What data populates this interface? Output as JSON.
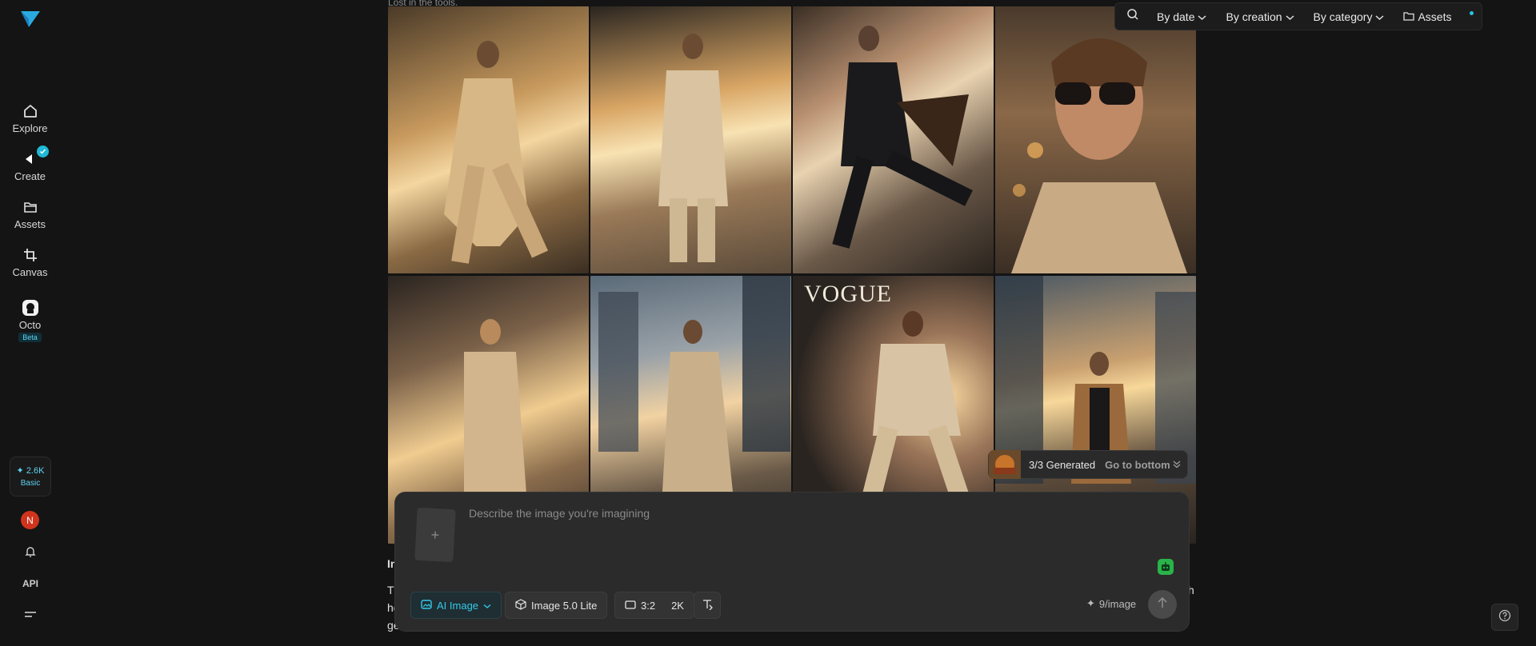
{
  "sidebar": {
    "nav": [
      {
        "label": "Explore",
        "icon": "home-icon"
      },
      {
        "label": "Create",
        "icon": "sparkle-pen-icon"
      },
      {
        "label": "Assets",
        "icon": "folder-icon"
      },
      {
        "label": "Canvas",
        "icon": "crop-icon"
      },
      {
        "label": "Octo",
        "icon": "octo-icon",
        "badge": "Beta"
      }
    ],
    "credits_value": "2.6K",
    "credits_tier": "Basic",
    "avatar_initial": "N",
    "api_label": "API"
  },
  "topbar": {
    "by_date": "By date",
    "by_creation": "By creation",
    "by_category": "By category",
    "assets": "Assets"
  },
  "header_cut_text": "Lost in the tools.",
  "generated": {
    "status": "3/3 Generated",
    "go_bottom": "Go to bottom"
  },
  "prompt": {
    "placeholder": "Describe the image you're imagining",
    "mode": "AI Image",
    "model": "Image 5.0 Lite",
    "ratio": "3:2",
    "resolution": "2K",
    "cost": "9/image"
  },
  "tile_caption": "VOGUE",
  "below_prompt": {
    "heading_start": "In",
    "line1_start": "Th",
    "line1_end": "h",
    "line2_start": "he",
    "line3_start": "ge."
  },
  "colors": {
    "accent": "#35c8e8",
    "avatar_bg": "#d0341c",
    "background": "#141414"
  }
}
